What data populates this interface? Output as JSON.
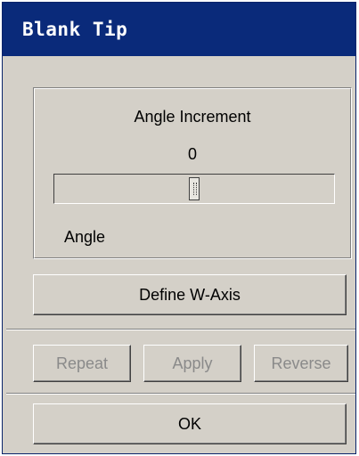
{
  "window": {
    "title": "Blank Tip"
  },
  "angle_panel": {
    "heading": "Angle Increment",
    "value": "0",
    "slider_position": 0.5,
    "caption": "Angle"
  },
  "define_axis_button": "Define W-Axis",
  "actions": {
    "repeat": "Repeat",
    "apply": "Apply",
    "reverse": "Reverse"
  },
  "ok_button": "OK"
}
